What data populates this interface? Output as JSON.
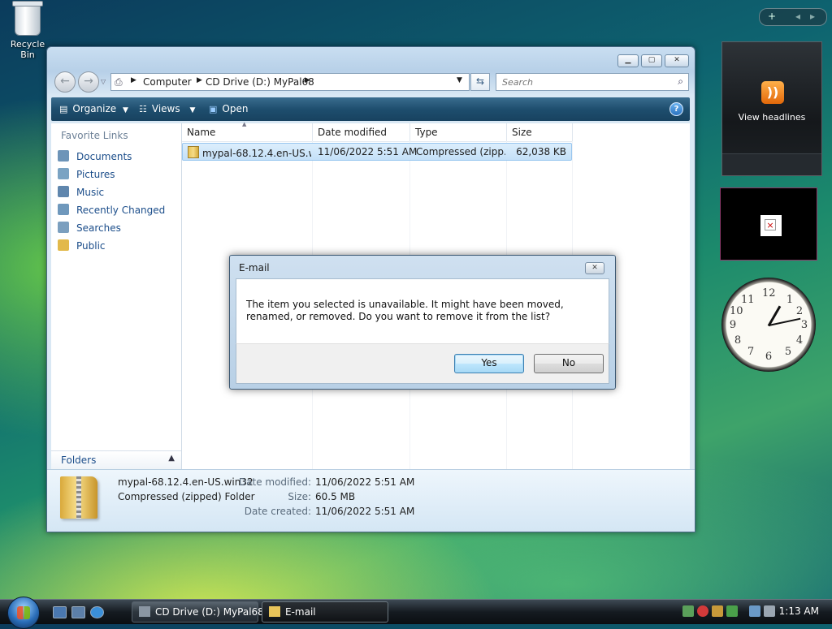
{
  "desktop": {
    "recycle_label": "Recycle Bin",
    "gadget_rss_label": "View headlines",
    "gadget_bar_add": "+",
    "gadget_bar_prev": "◂",
    "gadget_bar_next": "▸"
  },
  "window": {
    "breadcrumb": [
      "Computer",
      "CD Drive (D:) MyPal68"
    ],
    "search_placeholder": "Search",
    "toolbar": {
      "organize": "Organize",
      "views": "Views",
      "open": "Open"
    },
    "favorite_links_label": "Favorite Links",
    "links": [
      "Documents",
      "Pictures",
      "Music",
      "Recently Changed",
      "Searches",
      "Public"
    ],
    "folders_label": "Folders",
    "columns": [
      "Name",
      "Date modified",
      "Type",
      "Size"
    ],
    "files": [
      {
        "name": "mypal-68.12.4.en-US.w...",
        "modified": "11/06/2022 5:51 AM",
        "type": "Compressed (zipp...",
        "size": "62,038 KB"
      }
    ],
    "details": {
      "name": "mypal-68.12.4.en-US.win32",
      "type": "Compressed (zipped) Folder",
      "date_modified_label": "Date modified:",
      "date_modified": "11/06/2022 5:51 AM",
      "size_label": "Size:",
      "size": "60.5 MB",
      "date_created_label": "Date created:",
      "date_created": "11/06/2022 5:51 AM"
    }
  },
  "dialog": {
    "title": "E-mail",
    "message": "The item you selected is unavailable.  It might have been moved, renamed, or removed.  Do you want to remove it from the list?",
    "yes": "Yes",
    "no": "No"
  },
  "taskbar": {
    "tasks": [
      "CD Drive (D:) MyPal68",
      "E-mail"
    ],
    "time": "1:13 AM"
  }
}
